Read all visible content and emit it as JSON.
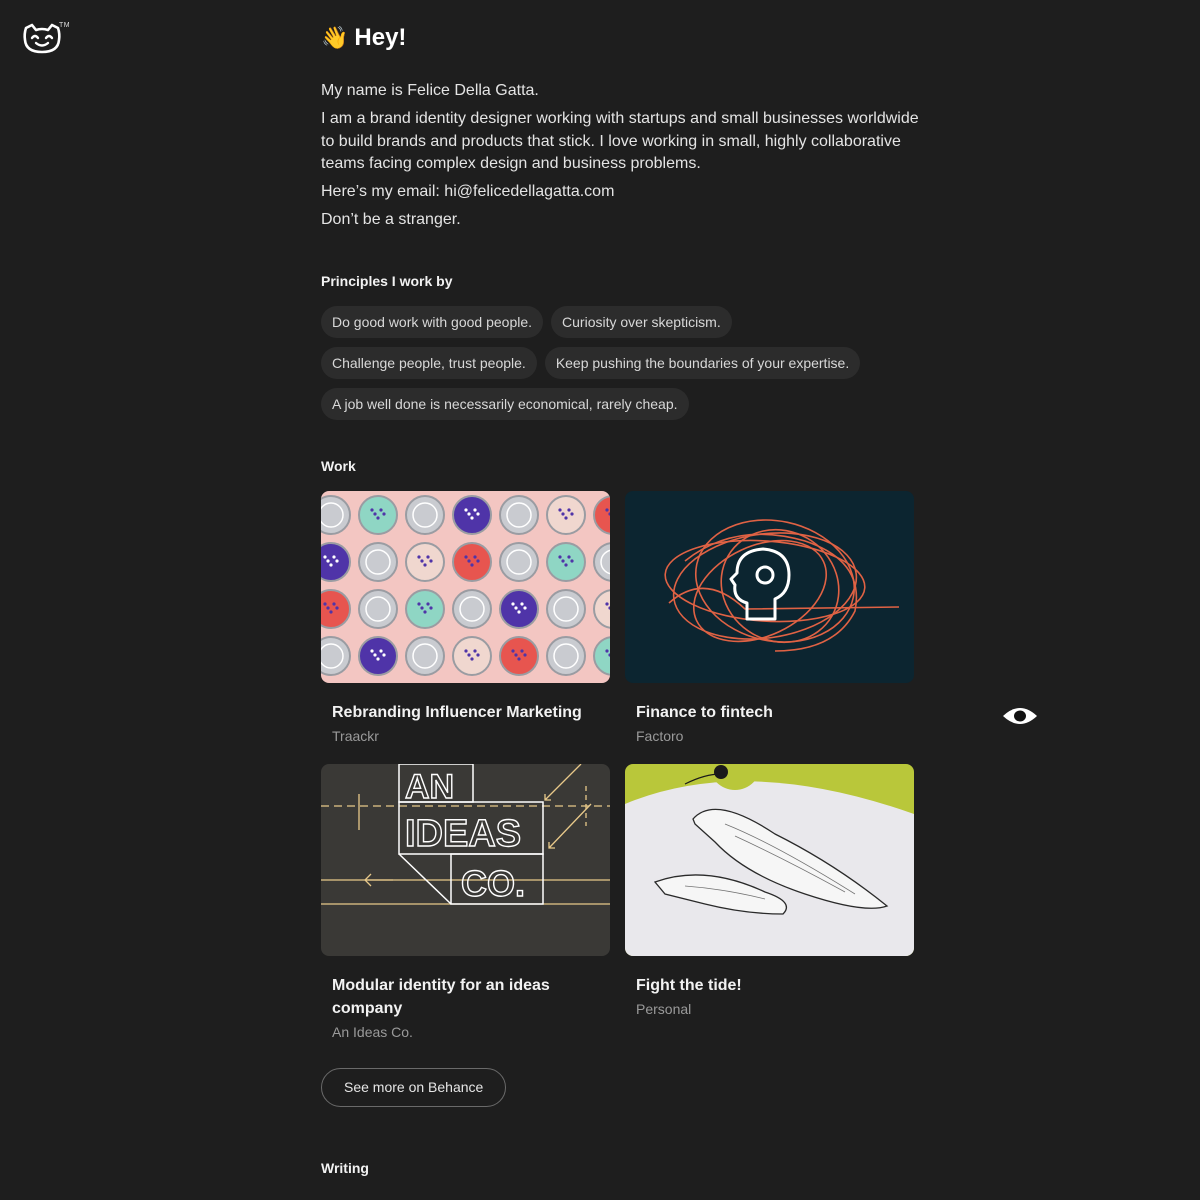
{
  "header": {
    "logo_icon": "cat-face-logo-icon",
    "trademark": "TM"
  },
  "hero": {
    "wave_emoji": "👋",
    "greeting": "Hey!"
  },
  "intro": {
    "name_line": "My name is Felice Della Gatta.",
    "bio": "I am a brand identity designer working with startups and small businesses worldwide to build brands and products that stick. I love working in small, highly collaborative teams facing complex design and business problems.",
    "email_label": "Here’s my email: ",
    "email": "hi@felicedellagatta.com",
    "closing": "Don’t be a stranger."
  },
  "principles": {
    "title": "Principles I work by",
    "items": [
      "Do good work with good people.",
      "Curiosity over skepticism.",
      "Challenge people, trust people.",
      "Keep pushing the boundaries of your expertise.",
      "A job well done is necessarily economical, rarely cheap."
    ]
  },
  "work": {
    "title": "Work",
    "items": [
      {
        "title": "Rebranding Influencer Marketing",
        "client": "Traackr"
      },
      {
        "title": "Finance to fintech",
        "client": "Factoro"
      },
      {
        "title": "Modular identity for an ideas company",
        "client": "An Ideas Co."
      },
      {
        "title": "Fight the tide!",
        "client": "Personal"
      }
    ],
    "thumb_texts": {
      "line1": "AN",
      "line2": "IDEAS",
      "line3": "CO."
    },
    "more_button": "See more on Behance"
  },
  "writing": {
    "title": "Writing"
  },
  "floating": {
    "eye_icon": "eye-icon"
  },
  "colors": {
    "background": "#1e1e1e",
    "chip": "#2c2c2c",
    "muted_text": "#9a9a9a"
  }
}
